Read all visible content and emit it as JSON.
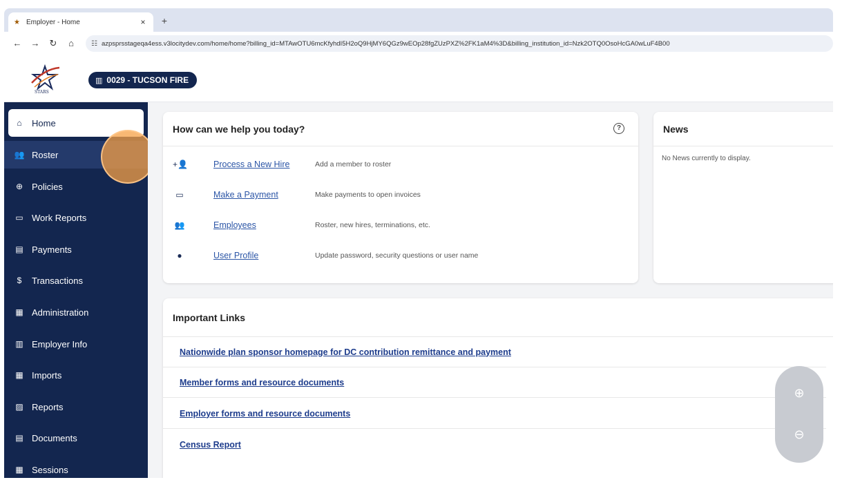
{
  "browser": {
    "tab_title": "Employer - Home",
    "tab_close": "×",
    "new_tab": "+",
    "url": "azpsprsstageqa4ess.v3locitydev.com/home/home?billing_id=MTAwOTU6mcKfyhdI5H2oQ9HjMY6QGz9wEOp28fgZUzPXZ%2FK1aM4%3D&billing_institution_id=Nzk2OTQ0OsoHcGA0wLuF4B00"
  },
  "header": {
    "logo_text": "STARS",
    "employer_label": "0029 - TUCSON FIRE"
  },
  "sidebar": {
    "items": [
      {
        "label": "Home",
        "icon": "home-icon",
        "glyph": "⌂"
      },
      {
        "label": "Roster",
        "icon": "group-icon",
        "glyph": "👥"
      },
      {
        "label": "Policies",
        "icon": "plus-circle-icon",
        "glyph": "⊕"
      },
      {
        "label": "Work Reports",
        "icon": "folder-icon",
        "glyph": "▭"
      },
      {
        "label": "Payments",
        "icon": "card-icon",
        "glyph": "▤"
      },
      {
        "label": "Transactions",
        "icon": "dollar-icon",
        "glyph": "$"
      },
      {
        "label": "Administration",
        "icon": "clipboard-icon",
        "glyph": "▦"
      },
      {
        "label": "Employer Info",
        "icon": "building-icon",
        "glyph": "▥"
      },
      {
        "label": "Imports",
        "icon": "import-icon",
        "glyph": "▦"
      },
      {
        "label": "Reports",
        "icon": "chart-icon",
        "glyph": "▨"
      },
      {
        "label": "Documents",
        "icon": "document-icon",
        "glyph": "▤"
      },
      {
        "label": "Sessions",
        "icon": "calendar-icon",
        "glyph": "▦"
      }
    ]
  },
  "help": {
    "title": "How can we help you today?",
    "help_glyph": "?",
    "rows": [
      {
        "link": "Process a New Hire",
        "desc": "Add a member to roster",
        "icon": "add-person-icon",
        "glyph": "+👤"
      },
      {
        "link": "Make a Payment",
        "desc": "Make payments to open invoices",
        "icon": "card-icon",
        "glyph": "▭"
      },
      {
        "link": "Employees",
        "desc": "Roster, new hires, terminations, etc.",
        "icon": "group-icon",
        "glyph": "👥"
      },
      {
        "link": "User Profile",
        "desc": "Update password, security questions or user name",
        "icon": "account-circle-icon",
        "glyph": "●"
      }
    ]
  },
  "news": {
    "title": "News",
    "empty_text": "No News currently to display."
  },
  "important_links": {
    "title": "Important Links",
    "links": [
      "Nationwide plan sponsor homepage for DC contribution remittance and payment",
      "Member forms and resource documents",
      "Employer forms and resource documents",
      "Census Report"
    ]
  },
  "zoom": {
    "in_glyph": "⊕",
    "out_glyph": "⊖"
  },
  "colors": {
    "sidebar": "#13264f",
    "link": "#2b55a6",
    "click_indicator": "#f5a046"
  }
}
